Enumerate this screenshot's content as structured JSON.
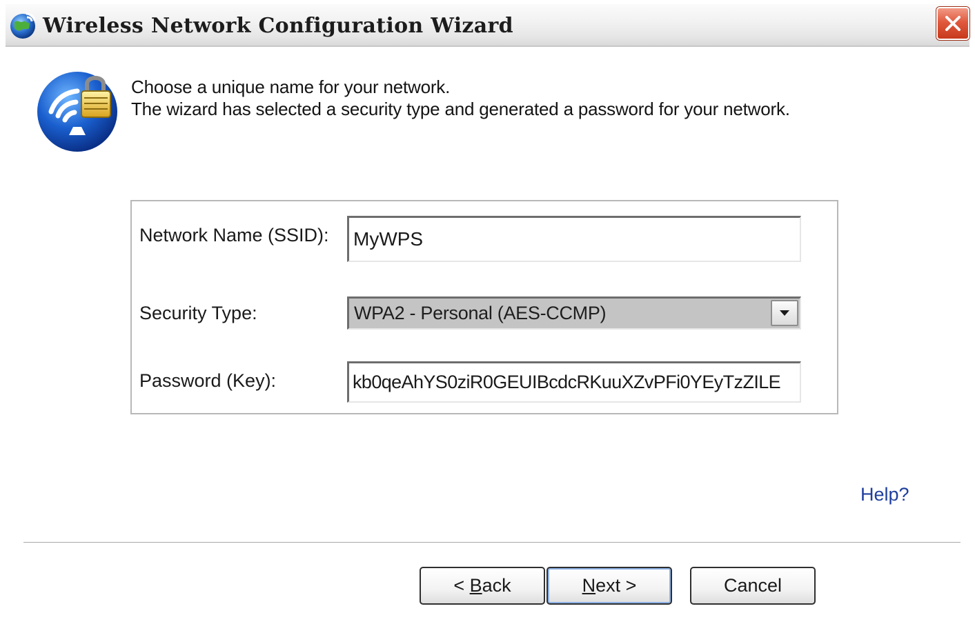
{
  "window": {
    "title": "Wireless Network Configuration Wizard",
    "title_icon": "globe-network-icon",
    "close_icon": "close-icon"
  },
  "header": {
    "icon": "wireless-security-lock-icon",
    "line1": "Choose a unique name for your network.",
    "line2": "The wizard has selected a security type and generated a password for your network."
  },
  "form": {
    "ssid_label": "Network Name (SSID):",
    "ssid_value": "MyWPS",
    "security_label": "Security Type:",
    "security_value": "WPA2 - Personal (AES-CCMP)",
    "password_label": "Password (Key):",
    "password_value": "kb0qeAhYS0ziR0GEUIBcdcRKuuXZvPFi0YEyTzZILE"
  },
  "help": {
    "label": "Help?"
  },
  "buttons": {
    "back": {
      "prefix": "< ",
      "accel": "B",
      "rest": "ack"
    },
    "next": {
      "accel": "N",
      "rest": "ext >"
    },
    "cancel": "Cancel"
  },
  "colors": {
    "link": "#1f3f9e",
    "close_button": "#d9482b",
    "select_background": "#c4c4c4"
  }
}
